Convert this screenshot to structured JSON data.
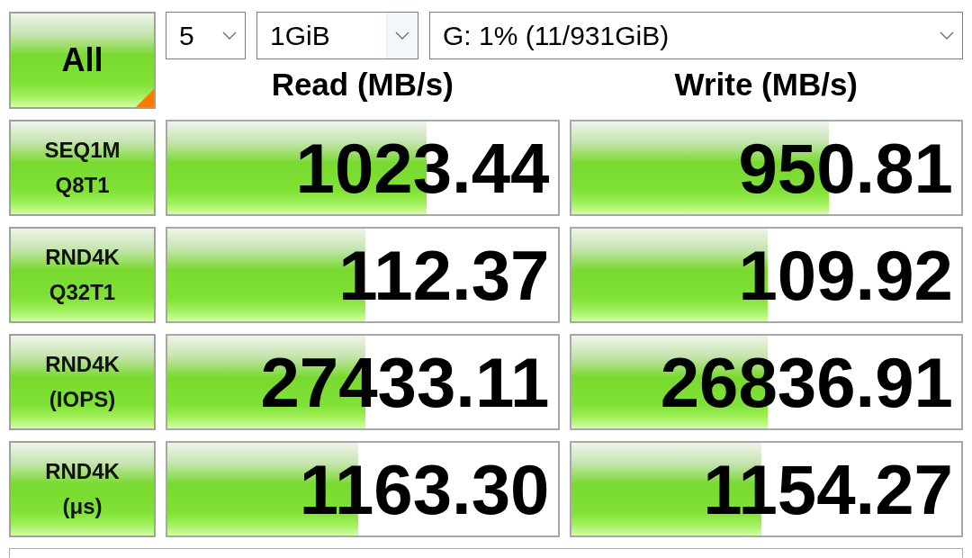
{
  "toolbar": {
    "all_button": {
      "label": "All"
    },
    "selects": [
      {
        "kind": "count",
        "value": "5",
        "highlighted": false
      },
      {
        "kind": "size",
        "value": "1GiB",
        "highlighted": true
      },
      {
        "kind": "drive",
        "value": "G: 1% (11/931GiB)",
        "highlighted": false
      }
    ]
  },
  "columns": [
    "Read (MB/s)",
    "Write (MB/s)"
  ],
  "rows": [
    {
      "label": [
        "SEQ1M",
        "Q8T1"
      ],
      "results": [
        {
          "value": "1023.44",
          "level": 0.665
        },
        {
          "value": "950.81",
          "level": 0.661
        }
      ]
    },
    {
      "label": [
        "RND4K",
        "Q32T1"
      ],
      "results": [
        {
          "value": "112.37",
          "level": 0.507
        },
        {
          "value": "109.92",
          "level": 0.503
        }
      ]
    },
    {
      "label": [
        "RND4K",
        "(IOPS)"
      ],
      "results": [
        {
          "value": "27433.11",
          "level": 0.507
        },
        {
          "value": "26836.91",
          "level": 0.503
        }
      ]
    },
    {
      "label": [
        "RND4K",
        "(μs)"
      ],
      "results": [
        {
          "value": "1163.30",
          "level": 0.489
        },
        {
          "value": "1154.27",
          "level": 0.487
        }
      ]
    }
  ]
}
